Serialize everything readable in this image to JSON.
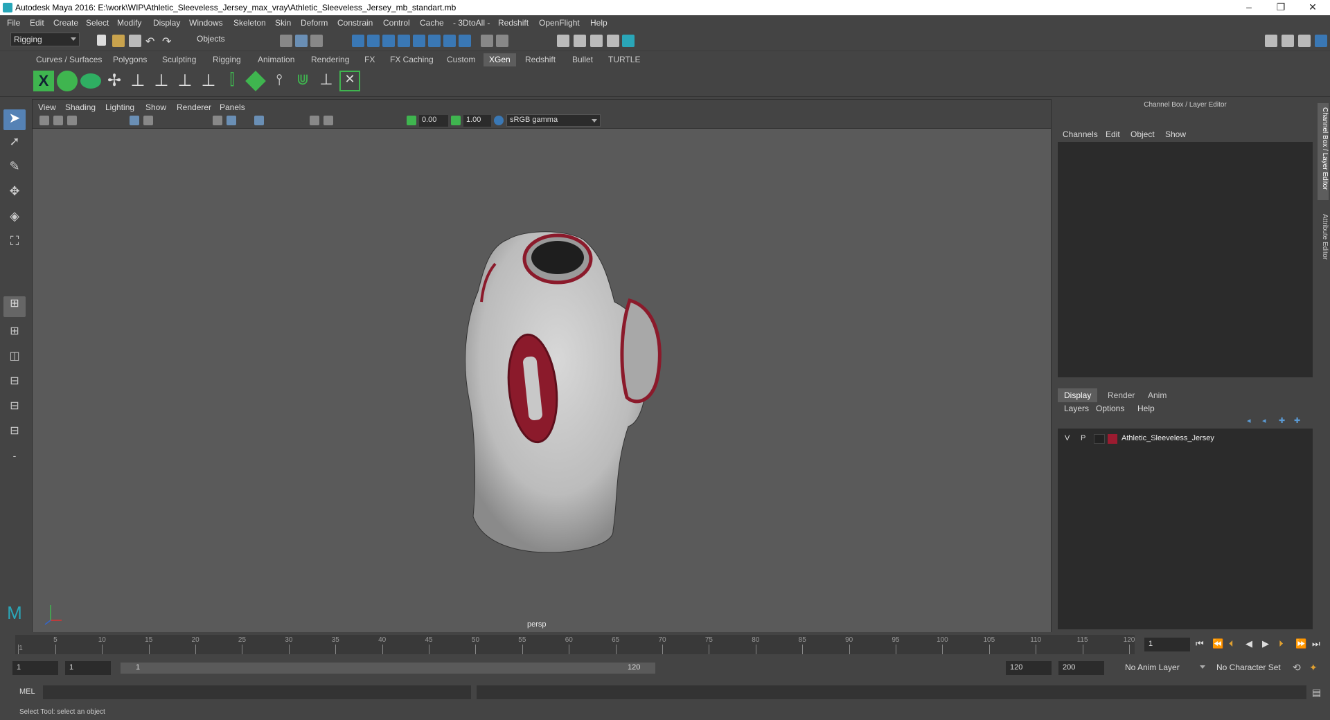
{
  "window": {
    "title": "Autodesk Maya 2016: E:\\work\\WIP\\Athletic_Sleeveless_Jersey_max_vray\\Athletic_Sleeveless_Jersey_mb_standart.mb",
    "minimize": "–",
    "maximize": "❐",
    "close": "✕"
  },
  "menubar": [
    "File",
    "Edit",
    "Create",
    "Select",
    "Modify",
    "Display",
    "Windows",
    "Skeleton",
    "Skin",
    "Deform",
    "Constrain",
    "Control",
    "Cache",
    "- 3DtoAll -",
    "Redshift",
    "OpenFlight",
    "Help"
  ],
  "statusline": {
    "menuset": "Rigging",
    "selection_mode": "Objects"
  },
  "shelf_tabs": [
    "Curves / Surfaces",
    "Polygons",
    "Sculpting",
    "Rigging",
    "Animation",
    "Rendering",
    "FX",
    "FX Caching",
    "Custom",
    "XGen",
    "Redshift",
    "Bullet",
    "TURTLE"
  ],
  "shelf_active": "XGen",
  "viewport": {
    "menu": [
      "View",
      "Shading",
      "Lighting",
      "Show",
      "Renderer",
      "Panels"
    ],
    "exposure": "0.00",
    "gamma": "1.00",
    "color_space": "sRGB gamma",
    "camera_label": "persp",
    "jersey_number": "0"
  },
  "channel_box": {
    "title": "Channel Box / Layer Editor",
    "menu": [
      "Channels",
      "Edit",
      "Object",
      "Show"
    ]
  },
  "layer_editor": {
    "tabs": [
      "Display",
      "Render",
      "Anim"
    ],
    "active_tab": "Display",
    "menu": [
      "Layers",
      "Options",
      "Help"
    ],
    "layers": [
      {
        "v": "V",
        "p": "P",
        "name": "Athletic_Sleeveless_Jersey",
        "color": "#9b1b30"
      }
    ]
  },
  "side_tabs": [
    "Channel Box / Layer Editor",
    "Attribute Editor"
  ],
  "timeslider": {
    "ticks": [
      1,
      5,
      10,
      15,
      20,
      25,
      30,
      35,
      40,
      45,
      50,
      55,
      60,
      65,
      70,
      75,
      80,
      85,
      90,
      95,
      100,
      105,
      110,
      115,
      120
    ],
    "current_frame": "1"
  },
  "range": {
    "start": "1",
    "playback_start": "1",
    "slider_start": "1",
    "slider_end": "120",
    "playback_end": "120",
    "end": "200",
    "anim_layer": "No Anim Layer",
    "character_set": "No Character Set"
  },
  "cmdline": {
    "label": "MEL"
  },
  "helpline": {
    "text": "Select Tool: select an object"
  },
  "colors": {
    "accent": "#27a6b8",
    "jersey_trim": "#8b1a2b",
    "xgen_green": "#3fb54f"
  }
}
